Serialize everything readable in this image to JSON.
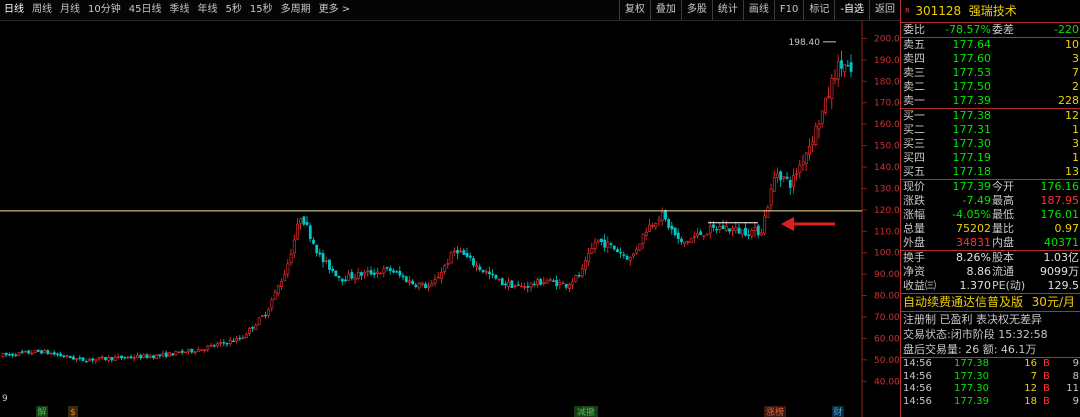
{
  "toolbar": {
    "periods": [
      "日线",
      "周线",
      "月线",
      "10分钟",
      "45日线",
      "季线",
      "年线",
      "5秒",
      "15秒",
      "多周期",
      "更多 >"
    ],
    "active_period": 0,
    "buttons": [
      "复权",
      "叠加",
      "多股",
      "统计",
      "画线",
      "F10",
      "标记",
      "-自选",
      "返回"
    ]
  },
  "stock": {
    "rmark": "R",
    "code": "301128",
    "name": "强瑞技术"
  },
  "order_book": {
    "weibi": {
      "label": "委比",
      "value": "-78.57%",
      "label2": "委差",
      "value2": "-220"
    },
    "asks": [
      {
        "label": "卖五",
        "price": "177.64",
        "vol": "10"
      },
      {
        "label": "卖四",
        "price": "177.60",
        "vol": "3"
      },
      {
        "label": "卖三",
        "price": "177.53",
        "vol": "7"
      },
      {
        "label": "卖二",
        "price": "177.50",
        "vol": "2"
      },
      {
        "label": "卖一",
        "price": "177.39",
        "vol": "228"
      }
    ],
    "bids": [
      {
        "label": "买一",
        "price": "177.38",
        "vol": "12"
      },
      {
        "label": "买二",
        "price": "177.31",
        "vol": "1"
      },
      {
        "label": "买三",
        "price": "177.30",
        "vol": "3"
      },
      {
        "label": "买四",
        "price": "177.19",
        "vol": "1"
      },
      {
        "label": "买五",
        "price": "177.18",
        "vol": "13"
      }
    ]
  },
  "quote": [
    {
      "l1": "现价",
      "v1": "177.39",
      "c1": "green",
      "l2": "今开",
      "v2": "176.16",
      "c2": "green"
    },
    {
      "l1": "涨跌",
      "v1": "-7.49",
      "c1": "green",
      "l2": "最高",
      "v2": "187.95",
      "c2": "red"
    },
    {
      "l1": "涨幅",
      "v1": "-4.05%",
      "c1": "green",
      "l2": "最低",
      "v2": "176.01",
      "c2": "green"
    },
    {
      "l1": "总量",
      "v1": "75202",
      "c1": "yellow",
      "l2": "量比",
      "v2": "0.97",
      "c2": "yellow"
    },
    {
      "l1": "外盘",
      "v1": "34831",
      "c1": "red",
      "l2": "内盘",
      "v2": "40371",
      "c2": "green"
    }
  ],
  "fundamentals": [
    {
      "l1": "换手",
      "v1": "8.26%",
      "l2": "股本",
      "v2": "1.03亿"
    },
    {
      "l1": "净资",
      "v1": "8.86",
      "l2": "流通",
      "v2": "9099万"
    },
    {
      "l1": "收益㈢",
      "v1": "1.370",
      "l2": "PE(动)",
      "v2": "129.5"
    }
  ],
  "ad": {
    "text": "自动续费通达信普及版",
    "price": "30元/月"
  },
  "info_lines": [
    "注册制 已盈利 表决权无差异",
    "交易状态:闭市阶段 15:32:58",
    "盘后交易量: 26 额: 46.1万"
  ],
  "ticks": [
    {
      "time": "14:56",
      "price": "177.38",
      "vol": "16",
      "bs": "B",
      "n": "9"
    },
    {
      "time": "14:56",
      "price": "177.30",
      "vol": "7",
      "bs": "B",
      "n": "8"
    },
    {
      "time": "14:56",
      "price": "177.30",
      "vol": "12",
      "bs": "B",
      "n": "11"
    },
    {
      "time": "14:56",
      "price": "177.39",
      "vol": "18",
      "bs": "B",
      "n": "9"
    }
  ],
  "chart_data": {
    "type": "candlestick",
    "y_ticks": [
      "200.0",
      "190.0",
      "180.0",
      "170.0",
      "160.0",
      "150.0",
      "140.0",
      "130.0",
      "120.0",
      "110.0",
      "100.0",
      "90.00",
      "80.00",
      "70.00",
      "60.00",
      "50.00",
      "40.00"
    ],
    "ylim": [
      35,
      203
    ],
    "max_label": "198.40",
    "max_value": 198.4,
    "hline": 119.5,
    "markers": [
      "解",
      "$",
      "减撤",
      "涨榜",
      "财"
    ],
    "corner_label": "9",
    "colors": {
      "up": "#ff3232",
      "down": "#00c8c8",
      "hline": "#f0e68c",
      "arrow": "#e02020"
    }
  }
}
